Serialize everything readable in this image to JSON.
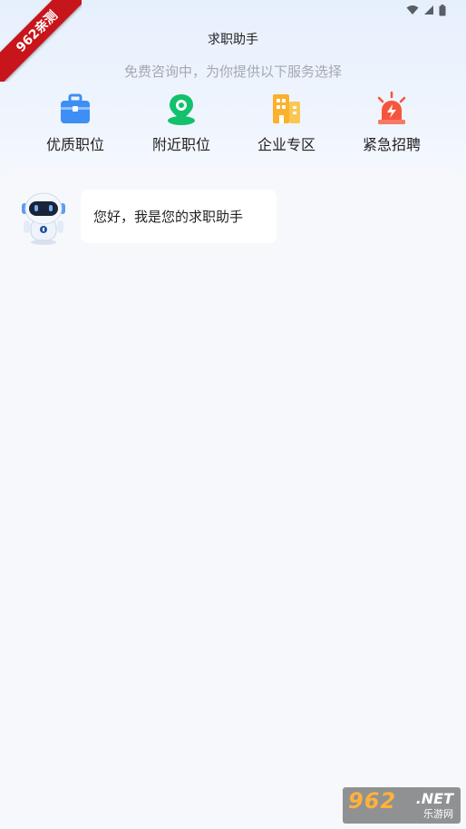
{
  "header": {
    "title": "求职助手",
    "subtitle": "免费咨询中，为你提供以下服务选择"
  },
  "services": [
    {
      "label": "优质职位",
      "icon": "briefcase-icon",
      "color": "#3d8ef5"
    },
    {
      "label": "附近职位",
      "icon": "location-pin-icon",
      "color": "#12c16b"
    },
    {
      "label": "企业专区",
      "icon": "building-icon",
      "color": "#fbb12b"
    },
    {
      "label": "紧急招聘",
      "icon": "alarm-light-icon",
      "color": "#f5553f"
    }
  ],
  "chat": {
    "messages": [
      {
        "sender": "assistant",
        "text": "您好，我是您的求职助手"
      }
    ]
  },
  "corner_badge": {
    "text": "962亲测"
  },
  "watermark": {
    "brand": "962",
    "net": ".NET",
    "site": "乐游网"
  }
}
